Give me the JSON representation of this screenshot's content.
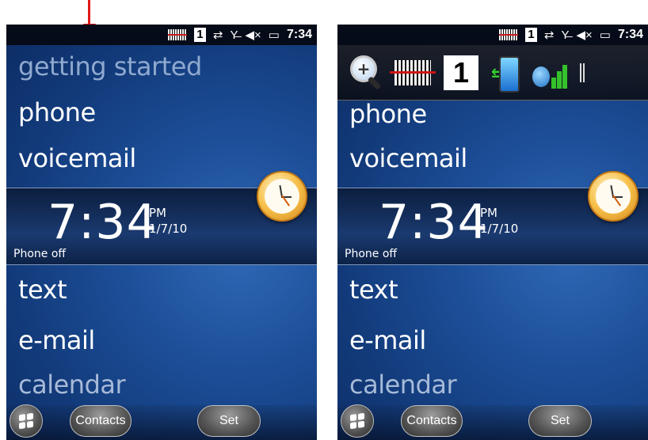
{
  "status_bar": {
    "one_indicator": "1",
    "time": "7:34",
    "icons": [
      "barcode-icon",
      "one-indicator",
      "data-sync-icon",
      "no-signal-icon",
      "speaker-mute-icon",
      "battery-charging-icon"
    ]
  },
  "menu_left": {
    "getting_started": "getting started",
    "phone": "phone",
    "voicemail": "voicemail",
    "text": "text",
    "email": "e-mail",
    "calendar": "calendar"
  },
  "menu_right": {
    "phone": "phone",
    "voicemail": "voicemail",
    "text": "text",
    "email": "e-mail",
    "calendar": "calendar"
  },
  "clock": {
    "time": "7:34",
    "ampm": "PM",
    "date": "1/7/10",
    "phone_status": "Phone off"
  },
  "bottom_bar": {
    "contacts_label": "Contacts",
    "set_label": "Set"
  },
  "quick_bar": {
    "one_label": "1",
    "icons": [
      "zoom-in-icon",
      "barcode-scanner-icon",
      "number-one-icon",
      "phone-sync-icon",
      "phone-signal-icon",
      "more-icon"
    ]
  },
  "colors": {
    "arrow": "#e01818",
    "background_blue": "#1d4f99"
  }
}
